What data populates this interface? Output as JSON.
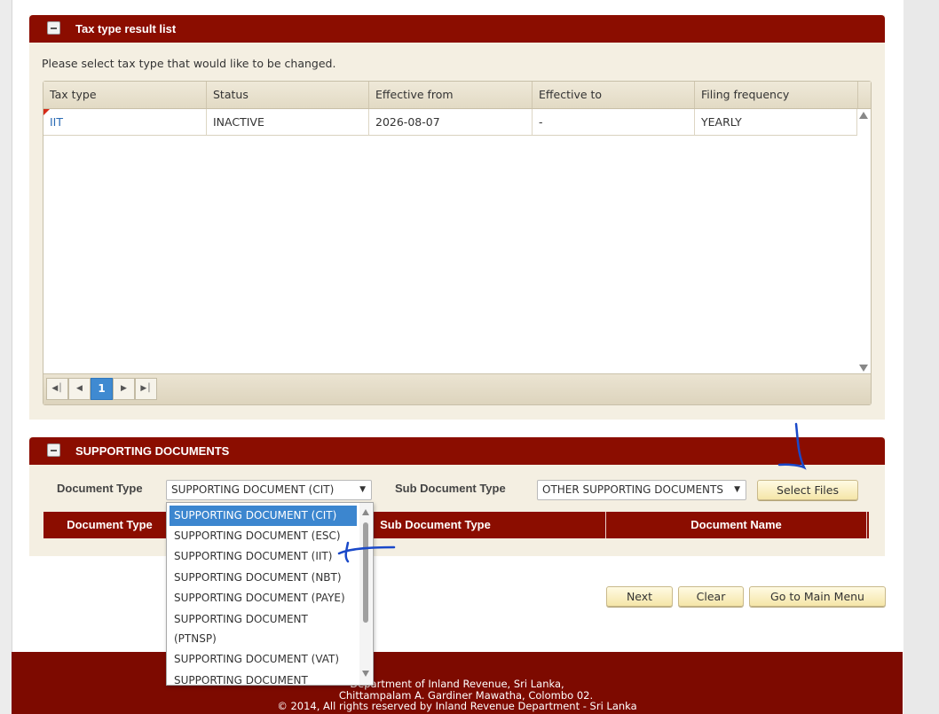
{
  "tax_panel": {
    "title": "Tax type result list",
    "intro": "Please select tax type that would like to be changed.",
    "columns": [
      "Tax type",
      "Status",
      "Effective from",
      "Effective to",
      "Filing frequency"
    ],
    "rows": [
      {
        "tax_type": "IIT",
        "status": "INACTIVE",
        "effective_from": "2026-08-07",
        "effective_to": "-",
        "filing_frequency": "YEARLY"
      }
    ],
    "pager": {
      "current_page": "1"
    }
  },
  "support_panel": {
    "title": "SUPPORTING DOCUMENTS",
    "document_type_label": "Document Type",
    "document_type_value": "SUPPORTING DOCUMENT (CIT)",
    "sub_document_type_label": "Sub Document Type",
    "sub_document_type_value": "OTHER SUPPORTING DOCUMENTS",
    "select_files_label": "Select Files",
    "table_headers": [
      "Document Type",
      "Sub Document Type",
      "Document Name"
    ],
    "dropdown_options": [
      "SUPPORTING DOCUMENT (CIT)",
      "SUPPORTING DOCUMENT (ESC)",
      "SUPPORTING DOCUMENT (IIT)",
      "SUPPORTING DOCUMENT (NBT)",
      "SUPPORTING DOCUMENT (PAYE)",
      "SUPPORTING DOCUMENT (PTNSP)",
      "SUPPORTING DOCUMENT (VAT)",
      "SUPPORTING DOCUMENT"
    ]
  },
  "actions": {
    "next": "Next",
    "clear": "Clear",
    "main_menu": "Go to Main Menu"
  },
  "footer": {
    "line1": "Department of Inland Revenue, Sri Lanka,",
    "line2": "Chittampalam A. Gardiner Mawatha, Colombo 02.",
    "line3": "© 2014, All rights reserved by Inland Revenue Department - Sri Lanka"
  },
  "colors": {
    "header_red": "#8b0d00",
    "panel_bg": "#f4efe2",
    "selected_blue": "#3c86cf",
    "annotation_blue": "#1a49c9"
  }
}
